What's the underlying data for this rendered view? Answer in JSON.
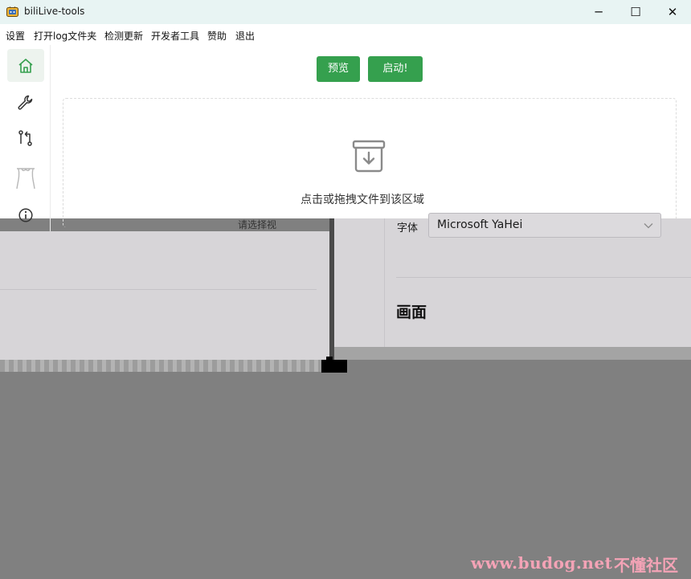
{
  "window": {
    "title": "biliLive-tools",
    "minimize_glyph": "─",
    "maximize_glyph": "☐",
    "close_glyph": "✕"
  },
  "menu": {
    "items": [
      {
        "label": "设置"
      },
      {
        "label": "打开log文件夹"
      },
      {
        "label": "检测更新"
      },
      {
        "label": "开发者工具"
      },
      {
        "label": "赞助"
      },
      {
        "label": "退出"
      }
    ]
  },
  "sidebar": {
    "items": [
      {
        "icon": "home-icon"
      },
      {
        "icon": "wrench-icon"
      },
      {
        "icon": "git-compare-icon"
      },
      {
        "icon": "curtain-icon"
      },
      {
        "icon": "info-icon"
      }
    ]
  },
  "toolbar": {
    "preview_label": "预览",
    "start_label": "启动!"
  },
  "dropzone": {
    "icon": "archive-download-icon",
    "text": "点击或拖拽文件到该区域",
    "choose_text": "请选择视"
  },
  "settings_panel": {
    "font_label": "字体",
    "font_value": "Microsoft YaHei",
    "section_title": "画面"
  },
  "watermark": {
    "url": "www.budog.net",
    "text": "不懂社区"
  },
  "colors": {
    "accent_green": "#35a04e",
    "titlebar_bg": "#e8f4f3",
    "overlay_grey": "#808080",
    "panel_grey": "#d7d5d8",
    "watermark_pink": "#f4a3b6"
  }
}
